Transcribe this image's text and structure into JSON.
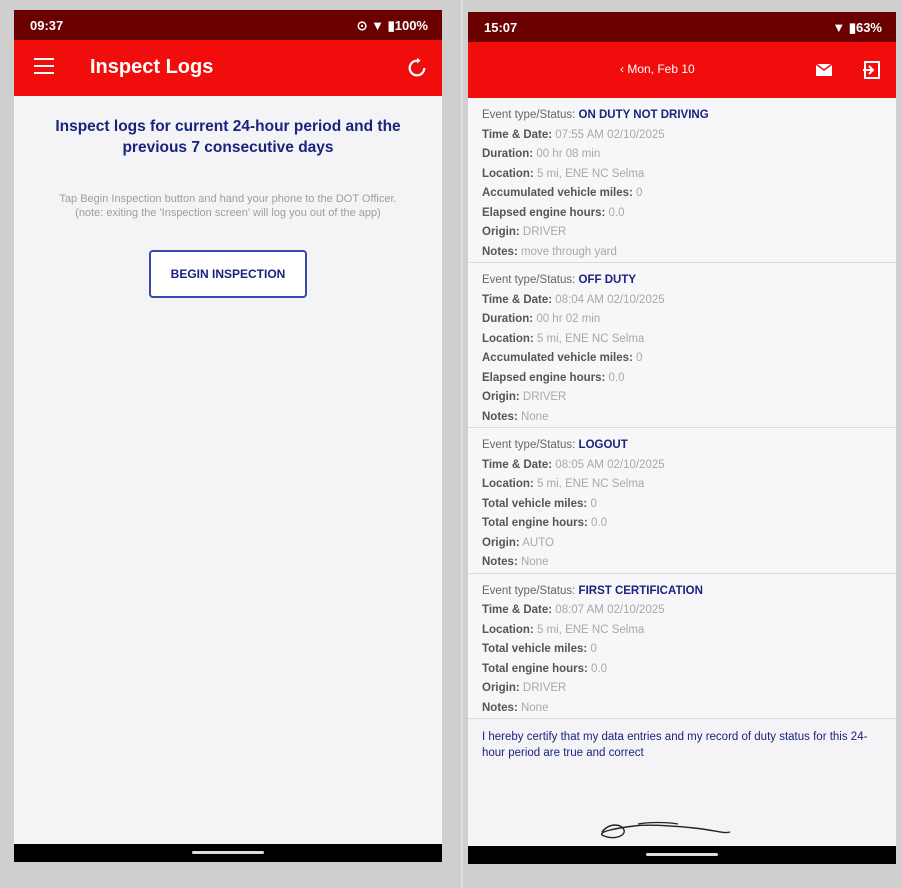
{
  "left": {
    "status_bar": {
      "time": "09:37",
      "right": "⊙ ▼ ▮100%"
    },
    "app_bar": {
      "title": "Inspect Logs"
    },
    "heading": "Inspect logs for current 24-hour period and the previous 7 consecutive days",
    "instructions": [
      "Tap Begin Inspection button and hand your phone to the DOT Officer.",
      "(note: exiting the 'Inspection screen' will log you out of the app)"
    ],
    "begin_button": "BEGIN INSPECTION"
  },
  "right": {
    "status_bar": {
      "time": "15:07",
      "right": "▼ ▮63%"
    },
    "app_bar": {
      "date": "‹ Mon, Feb 10"
    },
    "events": [
      {
        "type": "ON DUTY NOT DRIVING",
        "fields": [
          {
            "label": "Time & Date:",
            "value": "07:55 AM 02/10/2025"
          },
          {
            "label": "Duration:",
            "value": "00 hr 08 min"
          },
          {
            "label": "Location:",
            "value": "5 mi, ENE NC Selma"
          },
          {
            "label": "Accumulated vehicle miles:",
            "value": "0"
          },
          {
            "label": "Elapsed engine hours:",
            "value": "0.0"
          },
          {
            "label": "Origin:",
            "value": "DRIVER"
          },
          {
            "label": "Notes:",
            "value": "move through yard"
          }
        ]
      },
      {
        "type": "OFF DUTY",
        "fields": [
          {
            "label": "Time & Date:",
            "value": "08:04 AM 02/10/2025"
          },
          {
            "label": "Duration:",
            "value": "00 hr 02 min"
          },
          {
            "label": "Location:",
            "value": "5 mi, ENE NC Selma"
          },
          {
            "label": "Accumulated vehicle miles:",
            "value": "0"
          },
          {
            "label": "Elapsed engine hours:",
            "value": "0.0"
          },
          {
            "label": "Origin:",
            "value": "DRIVER"
          },
          {
            "label": "Notes:",
            "value": "None"
          }
        ]
      },
      {
        "type": "LOGOUT",
        "fields": [
          {
            "label": "Time & Date:",
            "value": "08:05 AM 02/10/2025"
          },
          {
            "label": "Location:",
            "value": "5 mi, ENE NC Selma"
          },
          {
            "label": "Total vehicle miles:",
            "value": "0"
          },
          {
            "label": "Total engine hours:",
            "value": "0.0"
          },
          {
            "label": "Origin:",
            "value": "AUTO"
          },
          {
            "label": "Notes:",
            "value": "None"
          }
        ]
      },
      {
        "type": "FIRST CERTIFICATION",
        "fields": [
          {
            "label": "Time & Date:",
            "value": "08:07 AM 02/10/2025"
          },
          {
            "label": "Location:",
            "value": "5 mi, ENE NC Selma"
          },
          {
            "label": "Total vehicle miles:",
            "value": "0"
          },
          {
            "label": "Total engine hours:",
            "value": "0.0"
          },
          {
            "label": "Origin:",
            "value": "DRIVER"
          },
          {
            "label": "Notes:",
            "value": "None"
          }
        ]
      }
    ],
    "event_type_label": "Event type/Status:",
    "certification_text": "I hereby certify that my data entries and my record of duty status for this 24-hour period are true and correct"
  }
}
